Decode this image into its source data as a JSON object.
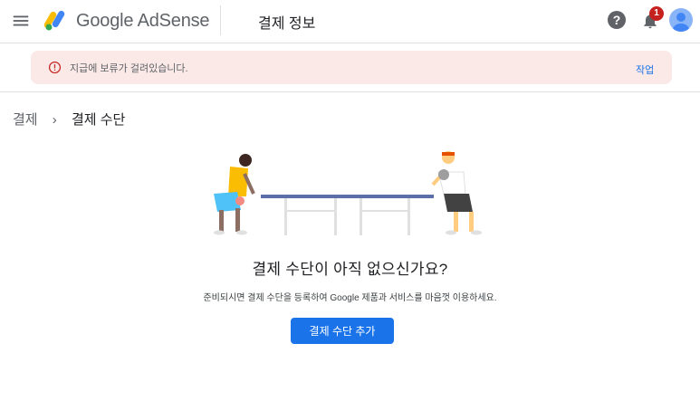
{
  "header": {
    "brand_google": "Google",
    "brand_product": "AdSense",
    "page_title": "결제 정보",
    "help_label": "?",
    "notification_count": "1"
  },
  "alert": {
    "message": "지급에 보류가 걸려있습니다.",
    "action_label": "작업"
  },
  "breadcrumb": {
    "parent": "결제",
    "separator": "›",
    "current": "결제 수단"
  },
  "empty_state": {
    "heading": "결제 수단이 아직 없으신가요?",
    "description": "준비되시면 결제 수단을 등록하여 Google 제품과 서비스를 마음껏 이용하세요.",
    "button_label": "결제 수단 추가"
  },
  "colors": {
    "primary": "#1a73e8",
    "alert_bg": "#fbe9e7",
    "alert_icon": "#c5221f",
    "badge": "#c5221f"
  },
  "icons": [
    "menu-icon",
    "adsense-logo",
    "help-icon",
    "bell-icon",
    "avatar-icon",
    "error-icon",
    "chevron-right-icon"
  ]
}
